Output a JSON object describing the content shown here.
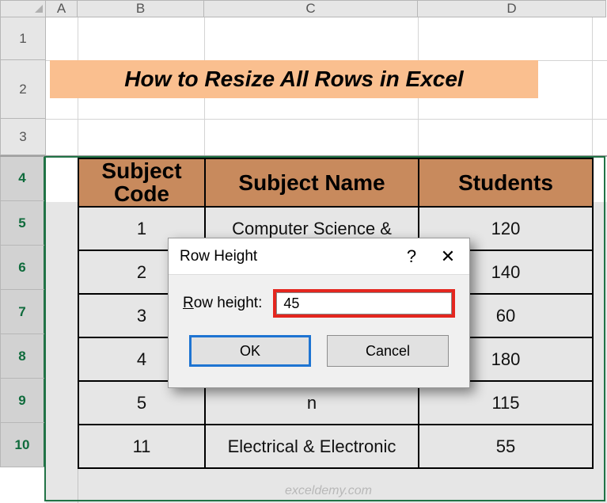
{
  "columns": {
    "A": "A",
    "B": "B",
    "C": "C",
    "D": "D"
  },
  "rows": {
    "r1": "1",
    "r2": "2",
    "r3": "3",
    "r4": "4",
    "r5": "5",
    "r6": "6",
    "r7": "7",
    "r8": "8",
    "r9": "9",
    "r10": "10"
  },
  "title": "How to Resize All Rows in Excel",
  "table": {
    "headers": {
      "code": "Subject Code",
      "name": "Subject Name",
      "students": "Students"
    },
    "rows": [
      {
        "code": "1",
        "name": "Computer Science &",
        "students": "120"
      },
      {
        "code": "2",
        "name": "",
        "students": "140"
      },
      {
        "code": "3",
        "name": "",
        "students": "60"
      },
      {
        "code": "4",
        "name": "",
        "students": "180"
      },
      {
        "code": "5",
        "name": "n",
        "students": "115"
      },
      {
        "code": "11",
        "name": "Electrical & Electronic",
        "students": "55"
      }
    ]
  },
  "dialog": {
    "title": "Row Height",
    "help": "?",
    "close": "✕",
    "label_pre": "R",
    "label_post": "ow height:",
    "value": "45",
    "ok": "OK",
    "cancel": "Cancel"
  },
  "watermark": "exceldemy.com",
  "chart_data": {
    "type": "table",
    "title": "How to Resize All Rows in Excel",
    "columns": [
      "Subject Code",
      "Subject Name",
      "Students"
    ],
    "rows": [
      [
        "1",
        "Computer Science &",
        120
      ],
      [
        "2",
        "",
        140
      ],
      [
        "3",
        "",
        60
      ],
      [
        "4",
        "",
        180
      ],
      [
        "5",
        "n",
        115
      ],
      [
        "11",
        "Electrical & Electronic",
        55
      ]
    ]
  }
}
